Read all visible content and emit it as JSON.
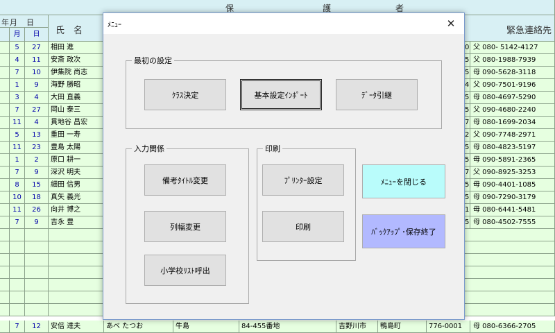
{
  "sheet": {
    "header_guardian": [
      "保",
      "護",
      "者"
    ],
    "header_ym": [
      "年",
      "月",
      "日"
    ],
    "header_ym2": [
      "月",
      "日"
    ],
    "header_name": "氏　名",
    "header_emergency": "緊急連絡先",
    "rows": [
      {
        "m": "5",
        "d": "27",
        "name": "相田 進",
        "tel": "父 080- 5142-4127",
        "ex": "0"
      },
      {
        "m": "4",
        "d": "11",
        "name": "安斎 政次",
        "tel": "父 080-1988-7939",
        "ex": "5"
      },
      {
        "m": "7",
        "d": "10",
        "name": "伊集院 尚志",
        "tel": "母 090-5628-3118",
        "ex": "5"
      },
      {
        "m": "1",
        "d": "9",
        "name": "海野 勝昭",
        "tel": "父 090-7501-9196",
        "ex": "4"
      },
      {
        "m": "3",
        "d": "4",
        "name": "大田 直義",
        "tel": "母 080-4697-5290",
        "ex": "5"
      },
      {
        "m": "7",
        "d": "27",
        "name": "岡山 泰三",
        "tel": "父 090-4680-2240",
        "ex": "5"
      },
      {
        "m": "11",
        "d": "4",
        "name": "貫地谷 昌宏",
        "tel": "母 080-1699-2034",
        "ex": "7"
      },
      {
        "m": "5",
        "d": "13",
        "name": "重田 一寿",
        "tel": "父 090-7748-2971",
        "ex": "2"
      },
      {
        "m": "11",
        "d": "23",
        "name": "豊島 太陽",
        "tel": "母 080-4823-5197",
        "ex": "5"
      },
      {
        "m": "1",
        "d": "2",
        "name": "原口 耕一",
        "tel": "母 090-5891-2365",
        "ex": "5"
      },
      {
        "m": "7",
        "d": "9",
        "name": "深沢 明夫",
        "tel": "父 090-8925-3253",
        "ex": "7"
      },
      {
        "m": "8",
        "d": "15",
        "name": "細田 信男",
        "tel": "母 090-4401-1085",
        "ex": "5"
      },
      {
        "m": "10",
        "d": "18",
        "name": "真矢 義光",
        "tel": "母 090-7290-3179",
        "ex": "5"
      },
      {
        "m": "11",
        "d": "26",
        "name": "向井 博之",
        "tel": "母 080-6441-5481",
        "ex": "1"
      },
      {
        "m": "7",
        "d": "9",
        "name": "吉永 豊",
        "tel": "母 080-4502-7555",
        "ex": "5"
      }
    ],
    "bottom_row": {
      "m": "7",
      "d": "12",
      "name": "安倍 達夫",
      "kana": "あべ たつお",
      "c1": "牛島",
      "addr": "84-455番地",
      "city": "吉野川市",
      "town": "鴨島町",
      "zip": "776-0001",
      "tel": "母 080-6366-2705"
    }
  },
  "dialog": {
    "title": "ﾒﾆｭｰ",
    "close": "✕",
    "group_initial": "最初の設定",
    "btn_class": "ｸﾗｽ決定",
    "btn_import": "基本設定ｲﾝﾎﾟｰﾄ",
    "btn_transfer": "ﾃﾞｰﾀ引継",
    "group_input": "入力関係",
    "btn_remarks": "備考ﾀｲﾄﾙ変更",
    "btn_colwidth": "列幅変更",
    "btn_school": "小学校ﾘｽﾄ呼出",
    "group_print": "印刷",
    "btn_printer": "ﾌﾟﾘﾝﾀｰ設定",
    "btn_print": "印刷",
    "btn_closemenu": "ﾒﾆｭｰを閉じる",
    "btn_backup": "ﾊﾞｯｸｱｯﾌﾟ･保存終了",
    "colors": {
      "cyan": "#b9fcfb",
      "blue": "#b2b9ff",
      "sheet_green": "#e6ffe0",
      "header_blue": "#d8f0f4"
    }
  }
}
